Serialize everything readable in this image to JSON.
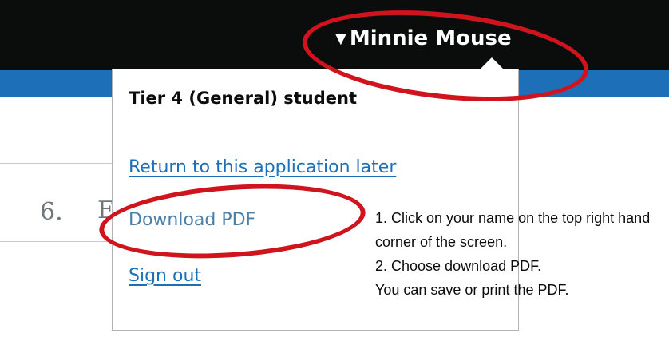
{
  "header": {
    "user_name": "Minnie Mouse",
    "caret_icon": "caret-down-icon"
  },
  "page": {
    "step_number": "6.",
    "step_fragment": "E"
  },
  "menu": {
    "title": "Tier 4 (General) student",
    "links": [
      {
        "label": "Return to this application later"
      },
      {
        "label": "Download PDF"
      },
      {
        "label": "Sign out"
      }
    ]
  },
  "instructions": {
    "line1": "1. Click on your name on the top right hand corner of the screen.",
    "line2": "2. Choose download PDF.",
    "line3": "You can save or print the PDF."
  },
  "colors": {
    "header": "#0b0c0c",
    "accent_blue": "#1d70b8",
    "annotation_red": "#d0141e"
  }
}
